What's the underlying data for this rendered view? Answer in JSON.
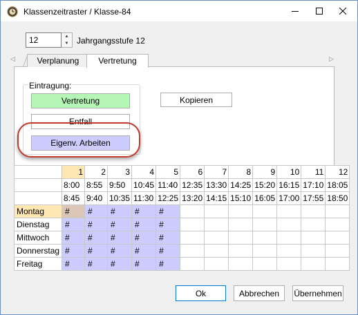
{
  "window": {
    "title": "Klassenzeitraster / Klasse-84"
  },
  "spinner": {
    "value": "12",
    "label": "Jahrgangsstufe 12"
  },
  "tabs": [
    {
      "label": "Verplanung"
    },
    {
      "label": "Vertretung"
    }
  ],
  "group": {
    "label": "Eintragung:",
    "buttons": {
      "vertretung": "Vertretung",
      "entfall": "Entfall",
      "eigenv": "Eigenv. Arbeiten"
    }
  },
  "kopieren_label": "Kopieren",
  "grid": {
    "periods": [
      "1",
      "2",
      "3",
      "4",
      "5",
      "6",
      "7",
      "8",
      "9",
      "10",
      "11",
      "12"
    ],
    "starts": [
      "8:00",
      "8:55",
      "9:50",
      "10:45",
      "11:40",
      "12:35",
      "13:30",
      "14:25",
      "15:20",
      "16:15",
      "17:10",
      "18:05"
    ],
    "ends": [
      "8:45",
      "9:40",
      "10:35",
      "11:30",
      "12:25",
      "13:20",
      "14:15",
      "15:10",
      "16:05",
      "17:00",
      "17:55",
      "18:50"
    ],
    "days": [
      "Montag",
      "Dienstag",
      "Mittwoch",
      "Donnerstag",
      "Freitag"
    ],
    "mark": "#"
  },
  "footer": {
    "ok": "Ok",
    "abbrechen": "Abbrechen",
    "uebernehmen": "Übernehmen"
  },
  "colors": {
    "vertretung": "#b5f5b5",
    "eigenv": "#ccccff",
    "grid_fill": "#ccccff",
    "active_header": "#ffe7b3",
    "highlight": "#c0392b"
  }
}
